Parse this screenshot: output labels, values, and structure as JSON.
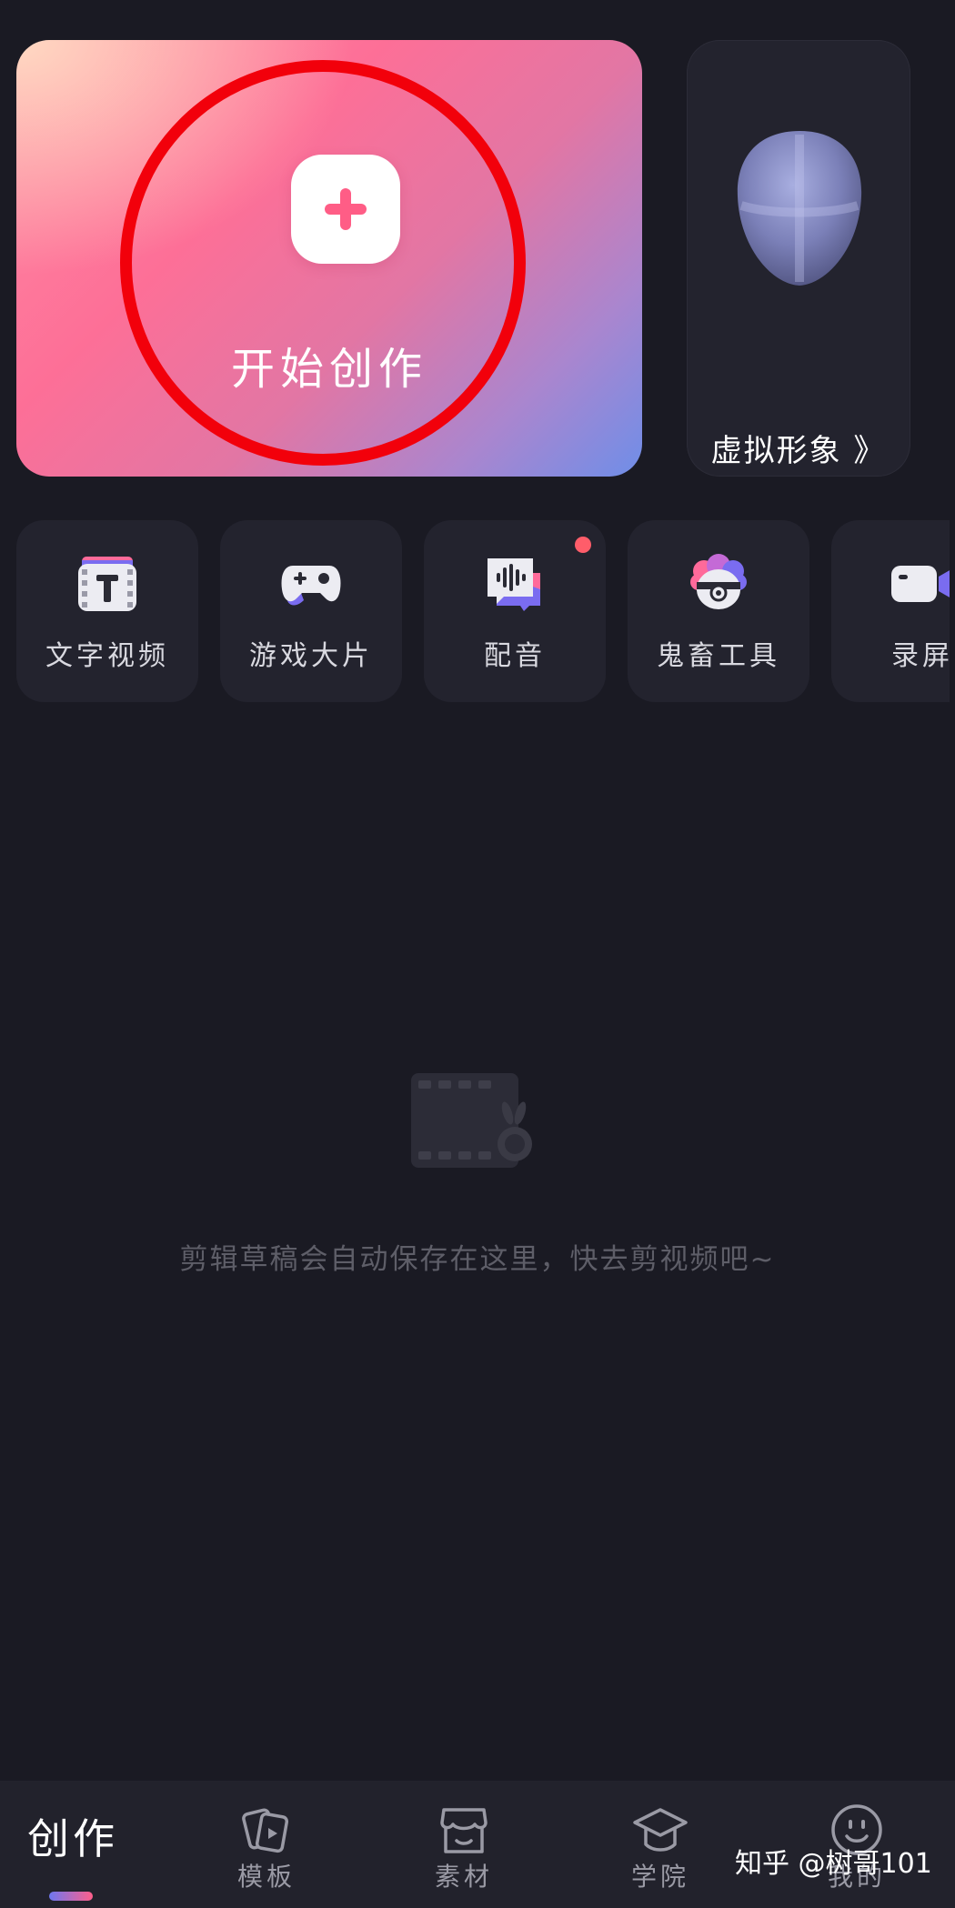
{
  "create_card": {
    "label": "开始创作",
    "icon": "plus-icon",
    "annotation": "red-circle-highlight"
  },
  "avatar_card": {
    "label": "虚拟形象 》",
    "icon": "mask-icon"
  },
  "tools": [
    {
      "label": "文字视频",
      "icon": "text-video-icon"
    },
    {
      "label": "游戏大片",
      "icon": "gamepad-icon"
    },
    {
      "label": "配音",
      "icon": "voiceover-icon",
      "badge": "red-dot"
    },
    {
      "label": "鬼畜工具",
      "icon": "sheep-icon"
    },
    {
      "label": "录屏",
      "icon": "camera-icon"
    }
  ],
  "empty_state": {
    "icon": "film-rabbit-icon",
    "text": "剪辑草稿会自动保存在这里，快去剪视频吧~"
  },
  "bottom_nav": {
    "items": [
      {
        "label": "创作",
        "active": true
      },
      {
        "label": "模板",
        "icon": "template-cards-icon"
      },
      {
        "label": "素材",
        "icon": "store-icon"
      },
      {
        "label": "学院",
        "icon": "graduation-cap-icon"
      },
      {
        "label": "我的",
        "icon": "smile-icon"
      }
    ]
  },
  "watermark": "知乎 @树哥101",
  "colors": {
    "background": "#1a1a23",
    "card": "#23232e",
    "accent_pink": "#fd6f97",
    "accent_blue": "#6f8ee8",
    "highlight_red": "#f2000b"
  }
}
